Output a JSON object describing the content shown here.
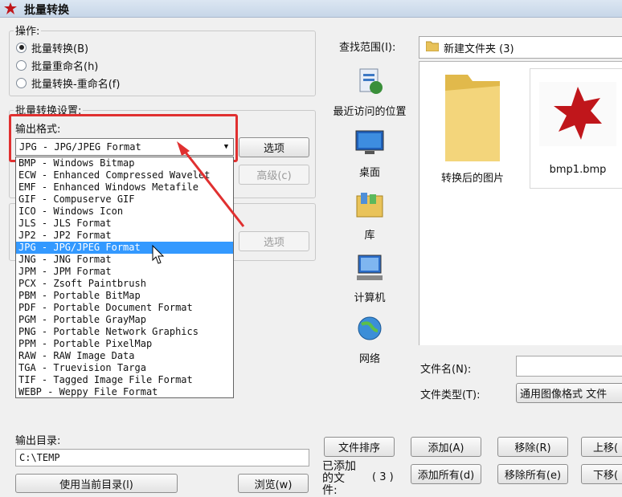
{
  "window": {
    "title": "批量转换",
    "app_icon": "red-cat-icon"
  },
  "operation": {
    "label": "操作:",
    "options": [
      {
        "label": "批量转换(B)",
        "selected": true
      },
      {
        "label": "批量重命名(h)",
        "selected": false
      },
      {
        "label": "批量转换-重命名(f)",
        "selected": false
      }
    ]
  },
  "settings": {
    "label": "批量转换设置:",
    "output_format_label": "输出格式:",
    "combo_value": "JPG - JPG/JPEG Format",
    "options_button": "选项",
    "advanced_button": "高级(c)",
    "options_button_2": "选项"
  },
  "format_list": [
    "BMP - Windows Bitmap",
    "ECW - Enhanced Compressed Wavelet",
    "EMF - Enhanced Windows Metafile",
    "GIF - Compuserve GIF",
    "ICO - Windows Icon",
    "JLS - JLS Format",
    "JP2 - JP2 Format",
    "JPG - JPG/JPEG Format",
    "JNG - JNG Format",
    "JPM - JPM Format",
    "PCX - Zsoft Paintbrush",
    "PBM - Portable BitMap",
    "PDF - Portable Document Format",
    "PGM - Portable GrayMap",
    "PNG - Portable Network Graphics",
    "PPM - Portable PixelMap",
    "RAW - RAW Image Data",
    "TGA - Truevision Targa",
    "TIF - Tagged Image File Format",
    "WEBP - Weppy File Format"
  ],
  "format_list_selected": "JPG - JPG/JPEG Format",
  "output_dir": {
    "label": "输出目录:",
    "value": "C:\\TEMP",
    "use_current_button": "使用当前目录(l)",
    "browse_button": "浏览(w)"
  },
  "browser": {
    "look_in_label": "查找范围(I):",
    "look_in_value": "新建文件夹 (3)",
    "places": [
      {
        "label": "最近访问的位置",
        "icon": "recent-places-icon"
      },
      {
        "label": "桌面",
        "icon": "desktop-icon"
      },
      {
        "label": "库",
        "icon": "library-icon"
      },
      {
        "label": "计算机",
        "icon": "computer-icon"
      },
      {
        "label": "网络",
        "icon": "network-icon"
      }
    ],
    "files": [
      {
        "name": "转换后的图片",
        "icon": "folder-icon"
      },
      {
        "name": "bmp1.bmp",
        "icon": "image-file-icon"
      }
    ],
    "filename_label": "文件名(N):",
    "filetype_label": "文件类型(T):",
    "filetype_value": "通用图像格式 文件"
  },
  "bottom": {
    "sort_button": "文件排序",
    "add_button": "添加(A)",
    "remove_button": "移除(R)",
    "move_up_button": "上移(",
    "added_label": "已添加的文件:",
    "added_count": "( 3 )",
    "add_all_button": "添加所有(d)",
    "remove_all_button": "移除所有(e)",
    "move_down_button": "下移("
  },
  "colors": {
    "highlight": "#e03030",
    "selection": "#3399ff"
  }
}
